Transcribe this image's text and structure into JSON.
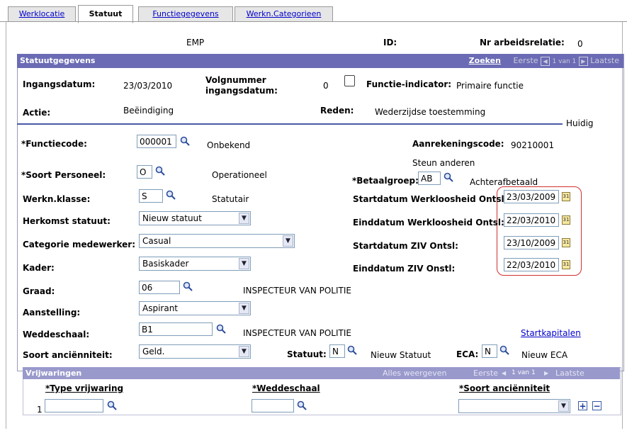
{
  "tabs": [
    {
      "label": "Werklocatie",
      "active": false
    },
    {
      "label": "Statuut",
      "active": true
    },
    {
      "label": "Functiegegevens",
      "active": false
    },
    {
      "label": "Werkn.Categorieen",
      "active": false
    }
  ],
  "header_row": {
    "emp_label": "EMP",
    "id_label": "ID:",
    "nr_label": "Nr arbeidsrelatie:",
    "nr_value": "0"
  },
  "section": {
    "title": "Statuutgegevens",
    "search_link": "Zoeken",
    "nav_first": "Eerste",
    "nav_count": "1 van 1",
    "nav_last": "Laatste"
  },
  "summary": {
    "ingangsdatum_label": "Ingangsdatum:",
    "ingangsdatum_value": "23/03/2010",
    "volgnummer_label_1": "Volgnummer",
    "volgnummer_label_2": "ingangsdatum:",
    "volgnummer_value": "0",
    "functie_indicator_label": "Functie-indicator:",
    "functie_indicator_value": "Primaire functie",
    "actie_label": "Actie:",
    "actie_value": "Beëindiging",
    "reden_label": "Reden:",
    "reden_value": "Wederzijdse toestemming",
    "huidig": "Huidig"
  },
  "fields": {
    "functiecode_label": "*Functiecode:",
    "functiecode_value": "000001",
    "functiecode_desc": "Onbekend",
    "aanrekeningscode_label": "Aanrekeningscode:",
    "aanrekeningscode_value": "90210001",
    "soort_personeel_label": "*Soort Personeel:",
    "soort_personeel_value": "O",
    "soort_personeel_desc": "Operationeel",
    "betaalgroep_label": "*Betaalgroep:",
    "betaalgroep_value": "AB",
    "betaalgroep_desc_1": "Steun anderen",
    "betaalgroep_desc_2": "Achterafbetaald",
    "werkn_klasse_label": "Werkn.klasse:",
    "werkn_klasse_value": "S",
    "werkn_klasse_desc": "Statutair",
    "herkomst_label": "Herkomst statuut:",
    "herkomst_value": "Nieuw statuut",
    "categorie_label": "Categorie medewerker:",
    "categorie_value": "Casual",
    "kader_label": "Kader:",
    "kader_value": "Basiskader",
    "graad_label": "Graad:",
    "graad_value": "06",
    "graad_desc": "INSPECTEUR VAN POLITIE",
    "aanstelling_label": "Aanstelling:",
    "aanstelling_value": "Aspirant",
    "weddeschaal_label": "Weddeschaal:",
    "weddeschaal_value": "B1",
    "weddeschaal_desc": "INSPECTEUR VAN POLITIE",
    "startkapitalen_link": "Startkapitalen",
    "soort_anc_label": "Soort anciënniteit:",
    "soort_anc_value": "Geld.",
    "statuut_label": "Statuut:",
    "statuut_value": "N",
    "statuut_desc": "Nieuw Statuut",
    "eca_label": "ECA:",
    "eca_value": "N",
    "eca_desc": "Nieuw ECA"
  },
  "dates": {
    "start_werkl_label": "Startdatum Werkloosheid Ontsl:",
    "start_werkl_value": "23/03/2009",
    "eind_werkl_label": "Einddatum Werkloosheid Ontsl:",
    "eind_werkl_value": "22/03/2010",
    "start_ziv_label": "Startdatum ZIV Ontsl:",
    "start_ziv_value": "23/10/2009",
    "eind_ziv_label": "Einddatum ZIV Onstl:",
    "eind_ziv_value": "22/03/2010"
  },
  "vrijwaringen": {
    "title": "Vrijwaringen",
    "show_all": "Alles weergeven",
    "nav_first": "Eerste",
    "nav_count": "1 van 1",
    "nav_last": "Laatste",
    "col_type": "*Type vrijwaring",
    "col_wedde": "*Weddeschaal",
    "col_soort": "*Soort anciënniteit",
    "row_number": "1",
    "add_symbol": "+",
    "remove_symbol": "−"
  }
}
